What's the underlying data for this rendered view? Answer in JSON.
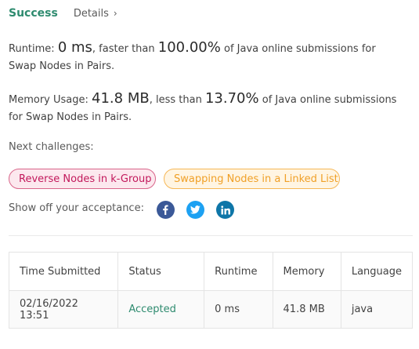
{
  "header": {
    "status": "Success",
    "details_label": "Details",
    "details_chevron": "›"
  },
  "runtime": {
    "label": "Runtime:",
    "value": "0 ms",
    "faster_text": ", faster than",
    "percent": "100.00%",
    "suffix": "of Java online submissions for Swap Nodes in Pairs."
  },
  "memory": {
    "label": "Memory Usage:",
    "value": "41.8 MB",
    "less_text": ", less than",
    "percent": "13.70%",
    "suffix": "of Java online submissions for Swap Nodes in Pairs."
  },
  "next_challenges": {
    "label": "Next challenges:",
    "items": [
      {
        "label": "Reverse Nodes in k-Group",
        "difficulty": "hard",
        "color": "#c2185b"
      },
      {
        "label": "Swapping Nodes in a Linked List",
        "difficulty": "medium",
        "color": "#f0a027"
      }
    ]
  },
  "share": {
    "label": "Show off your acceptance:",
    "icons": [
      "facebook-icon",
      "twitter-icon",
      "linkedin-icon"
    ],
    "colors": {
      "facebook": "#3b5998",
      "twitter": "#1da1f2",
      "linkedin": "#0e76a8"
    }
  },
  "table": {
    "headers": [
      "Time Submitted",
      "Status",
      "Runtime",
      "Memory",
      "Language"
    ],
    "rows": [
      [
        "02/16/2022 13:51",
        "Accepted",
        "0 ms",
        "41.8 MB",
        "java"
      ]
    ]
  },
  "colors": {
    "accent": "#2e8b6f"
  }
}
